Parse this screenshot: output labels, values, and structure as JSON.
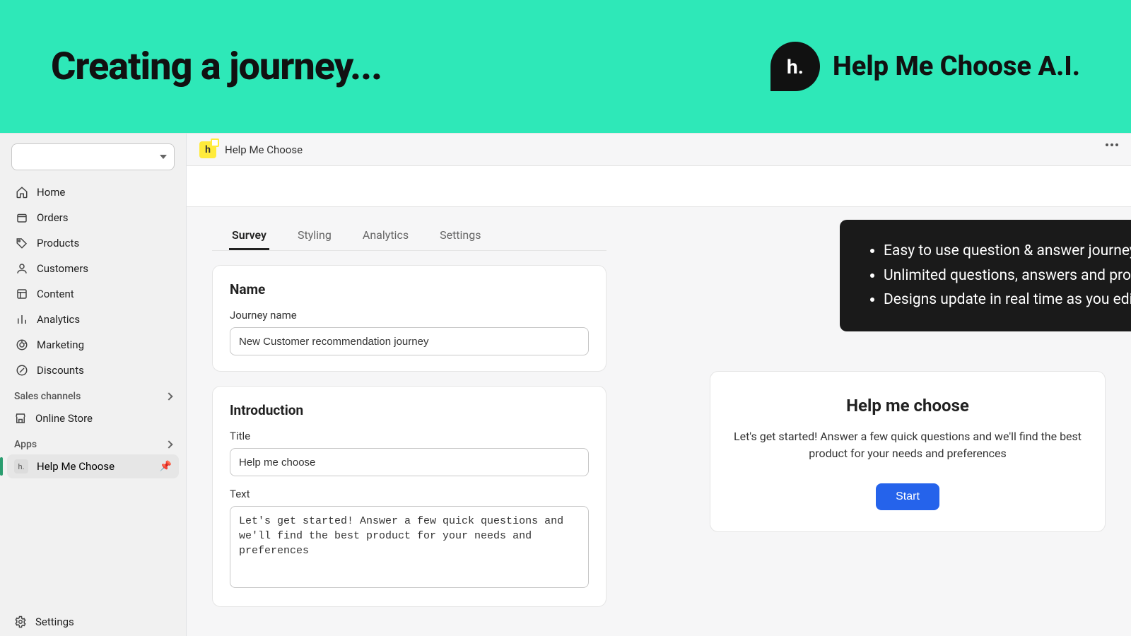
{
  "banner": {
    "title": "Creating a journey...",
    "brand": "Help Me Choose A.I.",
    "logo_text": "h."
  },
  "sidebar": {
    "items": [
      {
        "icon": "home",
        "label": "Home"
      },
      {
        "icon": "orders",
        "label": "Orders"
      },
      {
        "icon": "products",
        "label": "Products"
      },
      {
        "icon": "customers",
        "label": "Customers"
      },
      {
        "icon": "content",
        "label": "Content"
      },
      {
        "icon": "analytics",
        "label": "Analytics"
      },
      {
        "icon": "marketing",
        "label": "Marketing"
      },
      {
        "icon": "discounts",
        "label": "Discounts"
      }
    ],
    "section_sales": "Sales channels",
    "online_store": "Online Store",
    "section_apps": "Apps",
    "app_item": "Help Me Choose",
    "app_item_short": "h.",
    "settings": "Settings"
  },
  "header": {
    "app_name": "Help Me Choose",
    "badge_letter": "h"
  },
  "tabs": {
    "survey": "Survey",
    "styling": "Styling",
    "analytics": "Analytics",
    "settings": "Settings"
  },
  "name_card": {
    "title": "Name",
    "label": "Journey name",
    "value": "New Customer recommendation journey"
  },
  "intro_card": {
    "title": "Introduction",
    "title_label": "Title",
    "title_value": "Help me choose",
    "text_label": "Text",
    "text_value": "Let's get started! Answer a few quick questions and we'll find the best product for your needs and preferences"
  },
  "preview": {
    "title": "Help me choose",
    "text": "Let's get started! Answer a few quick questions and we'll find the best product for your needs and preferences",
    "button": "Start"
  },
  "tooltip": {
    "b1": "Easy to use question & answer journey editor",
    "b2": "Unlimited questions, answers and products",
    "b3": "Designs update in real time as you edit"
  }
}
